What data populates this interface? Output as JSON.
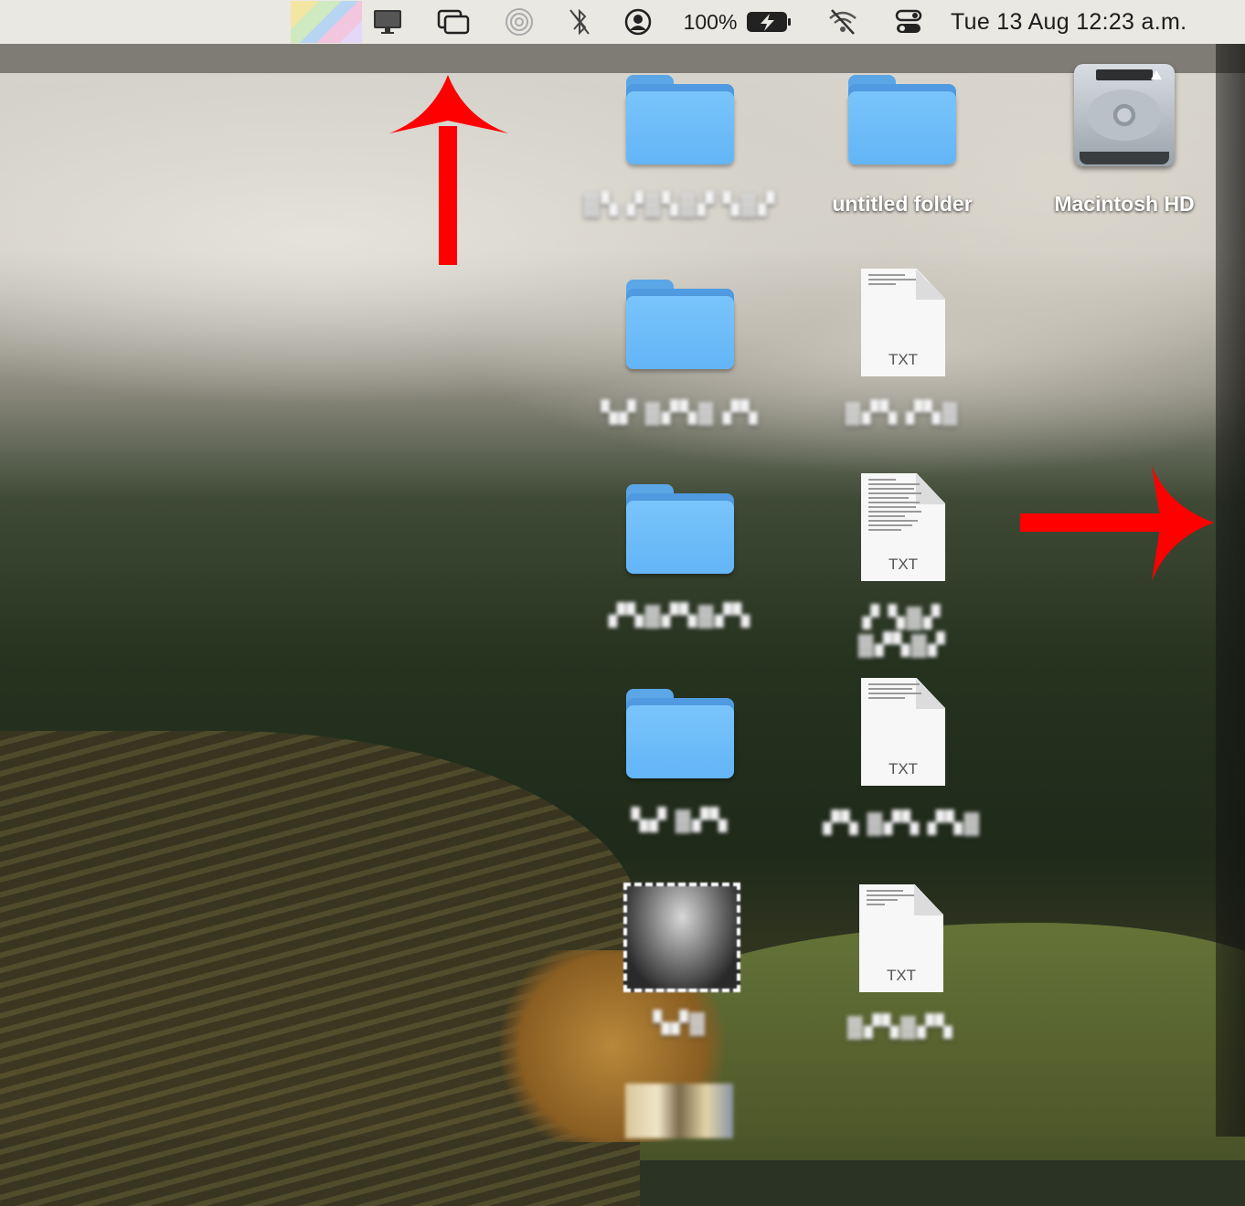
{
  "menubar": {
    "battery_percent": "100%",
    "clock": "Tue 13 Aug  12:23 a.m.",
    "icons": [
      "display-icon",
      "screen-mirroring-icon",
      "airdrop-icon",
      "bluetooth-off-icon",
      "user-icon",
      "battery-charging-icon",
      "wifi-off-icon",
      "control-center-icon"
    ]
  },
  "desktop": {
    "items": [
      {
        "kind": "folder",
        "label": "▓▚ ▞▓▚▓▞ ▚▓▞"
      },
      {
        "kind": "folder",
        "label": "untitled folder"
      },
      {
        "kind": "drive",
        "label": "Macintosh HD"
      },
      {
        "kind": "folder",
        "label": "▚▞ ▓▞▚▓ ▞▚"
      },
      {
        "kind": "txt",
        "ext": "TXT",
        "label": "▓▞▚ ▞▚▓"
      },
      {
        "kind": "folder",
        "label": "▞▚▓▞▚▓▞▚"
      },
      {
        "kind": "txt",
        "ext": "TXT",
        "label": "▞ ▚▓▞ ▓▞▚▓▞"
      },
      {
        "kind": "folder",
        "label": "▚▞ ▓▞▚"
      },
      {
        "kind": "txt",
        "ext": "TXT",
        "label": "▞▚ ▓▞▚ ▞▚▓"
      },
      {
        "kind": "image",
        "label": "▚▞▓"
      },
      {
        "kind": "txt",
        "ext": "TXT",
        "label": "▓▞▚▓▞▚"
      },
      {
        "kind": "image",
        "label": ""
      }
    ]
  },
  "annotations": {
    "arrow_color": "#ff0000"
  }
}
